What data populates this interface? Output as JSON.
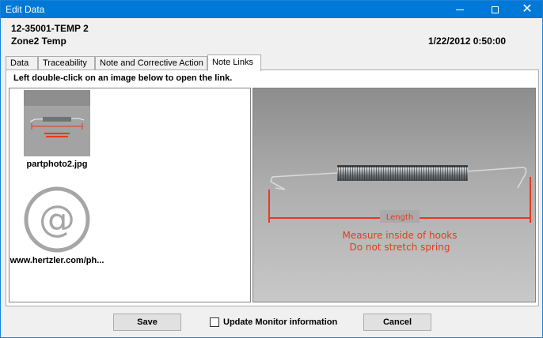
{
  "window": {
    "title": "Edit Data"
  },
  "header": {
    "id": "12-35001-TEMP 2",
    "name": "Zone2 Temp",
    "timestamp": "1/22/2012 0:50:00"
  },
  "tabs": [
    {
      "label": "Data",
      "active": false
    },
    {
      "label": "Traceability",
      "active": false
    },
    {
      "label": "Note and Corrective Action",
      "active": false
    },
    {
      "label": "Note Links",
      "active": true
    }
  ],
  "note_links": {
    "instruction": "Left double-click on an image below to open the link.",
    "items": [
      {
        "label": "partphoto2.jpg",
        "kind": "image"
      },
      {
        "label": "www.hertzler.com/ph...",
        "kind": "web-link",
        "glyph": "@"
      }
    ],
    "preview": {
      "length_label": "Length",
      "caption_line1": "Measure inside of hooks",
      "caption_line2": "Do not stretch spring"
    }
  },
  "footer": {
    "save_label": "Save",
    "checkbox_label": "Update Monitor information",
    "checkbox_checked": false,
    "cancel_label": "Cancel"
  },
  "colors": {
    "titlebar": "#0078d7",
    "annotation_red": "#e63a1e",
    "link_icon_gray": "#a6a6a6"
  }
}
